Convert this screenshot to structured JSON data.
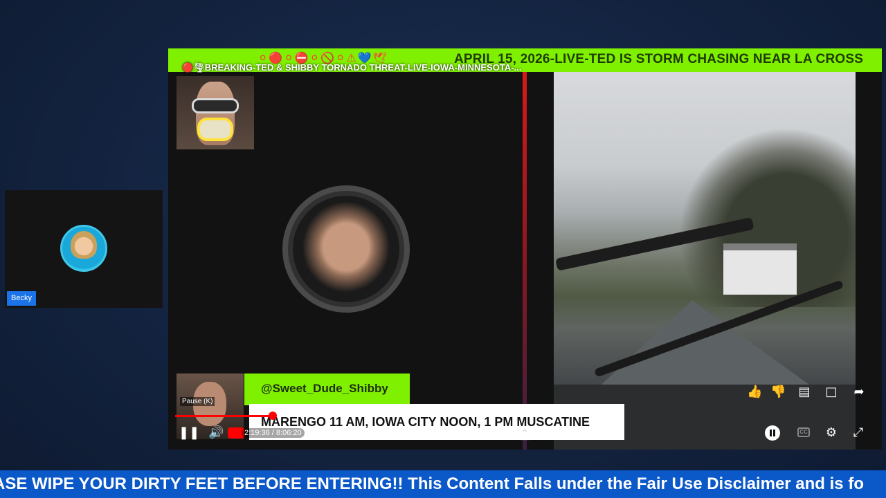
{
  "side_tile": {
    "participant_name": "Becky"
  },
  "banner": {
    "emoji_strip": "⚪🔴⚪⛔⚪🚫⚪⚠💙🕊",
    "headline": "APRIL 15, 2026-LIVE-TED IS STORM CHASING NEAR LA CROSS",
    "video_title": "🔴🌪BREAKING-TED & SHIBBY TORNADO THREAT-LIVE-IOWA-MINNESOTA-..."
  },
  "overlay": {
    "handle": "@Sweet_Dude_Shibby",
    "lower_third": "MARENGO 11 AM, IOWA CITY NOON, 1 PM MUSCATINE",
    "pause_tooltip": "Pause (K)"
  },
  "player": {
    "time_display": "2:19:36 / 8:06:20",
    "progress_fraction": 0.288,
    "icons": {
      "play": "pause-icon",
      "volume": "volume-icon",
      "like": "thumbs-up-icon",
      "dislike": "thumbs-down-icon",
      "comment": "comment-icon",
      "chat": "chat-icon",
      "share": "share-icon",
      "cc": "CC",
      "settings": "gear-icon",
      "fullscreen": "exit-fullscreen-icon"
    }
  },
  "ticker": {
    "text": "ASE WIPE YOUR DIRTY FEET BEFORE ENTERING!! This Content Falls under the Fair Use Disclaimer and is fo"
  },
  "colors": {
    "banner_green": "#7ff000",
    "ticker_blue": "#0b58c9",
    "name_badge_blue": "#1a73e8",
    "progress_red": "#ff0000"
  }
}
